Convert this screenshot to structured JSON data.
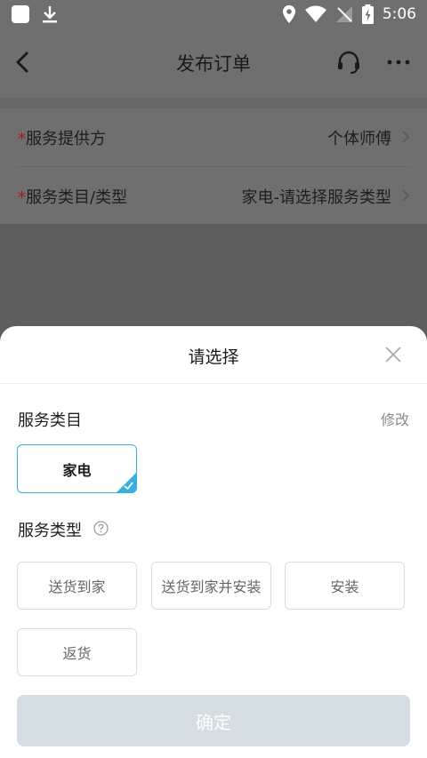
{
  "status_bar": {
    "time": "5:06"
  },
  "header": {
    "title": "发布订单"
  },
  "form": {
    "rows": [
      {
        "required_mark": "*",
        "label": "服务提供方",
        "value": "个体师傅"
      },
      {
        "required_mark": "*",
        "label": "服务类目/类型",
        "value": "家电-请选择服务类型"
      }
    ]
  },
  "sheet": {
    "title": "请选择",
    "category_title": "服务类目",
    "edit_label": "修改",
    "selected_category": "家电",
    "type_title": "服务类型",
    "types": [
      "送货到家",
      "送货到家并安装",
      "安装",
      "返货"
    ],
    "confirm_label": "确定"
  },
  "colors": {
    "accent": "#38b0dc",
    "required": "#c62828",
    "confirm_disabled": "#d3dde2"
  }
}
